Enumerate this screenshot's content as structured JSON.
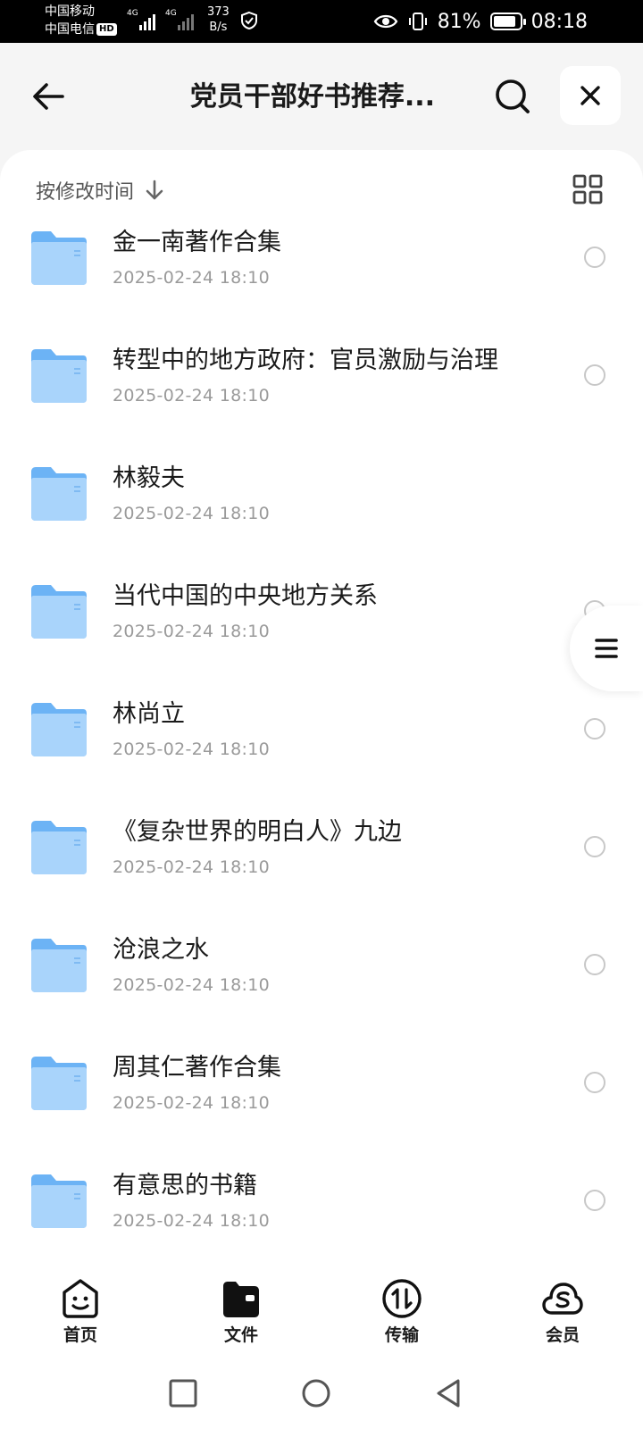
{
  "status_bar": {
    "carrier1": "中国移动",
    "carrier2": "中国电信",
    "hd": "HD",
    "net1": "4G",
    "net2": "4G",
    "speed_value": "373",
    "speed_unit": "B/s",
    "battery": "81%",
    "time": "08:18"
  },
  "header": {
    "title": "党员干部好书推荐...",
    "back_icon": "arrow-left-icon",
    "search_icon": "search-icon",
    "close_icon": "close-icon"
  },
  "sort": {
    "label": "按修改时间",
    "direction_icon": "arrow-down-icon",
    "view_icon": "grid-view-icon"
  },
  "files": [
    {
      "name": "金一南著作合集",
      "date": "2025-02-24 18:10"
    },
    {
      "name": "转型中的地方政府：官员激励与治理",
      "date": "2025-02-24 18:10"
    },
    {
      "name": "林毅夫",
      "date": "2025-02-24 18:10"
    },
    {
      "name": "当代中国的中央地方关系",
      "date": "2025-02-24 18:10"
    },
    {
      "name": "林尚立",
      "date": "2025-02-24 18:10"
    },
    {
      "name": "《复杂世界的明白人》九边",
      "date": "2025-02-24 18:10"
    },
    {
      "name": "沧浪之水",
      "date": "2025-02-24 18:10"
    },
    {
      "name": "周其仁著作合集",
      "date": "2025-02-24 18:10"
    },
    {
      "name": "有意思的书籍",
      "date": "2025-02-24 18:10"
    }
  ],
  "bottom_nav": [
    {
      "label": "首页",
      "icon": "home-smile-icon"
    },
    {
      "label": "文件",
      "icon": "files-folder-icon"
    },
    {
      "label": "传输",
      "icon": "transfer-icon"
    },
    {
      "label": "会员",
      "icon": "vip-cloud-icon"
    }
  ],
  "colors": {
    "folder_light": "#a9d4fb",
    "folder_dark": "#6cb3f5",
    "text_primary": "#1a1a1a",
    "text_secondary": "#9a9a9a"
  }
}
